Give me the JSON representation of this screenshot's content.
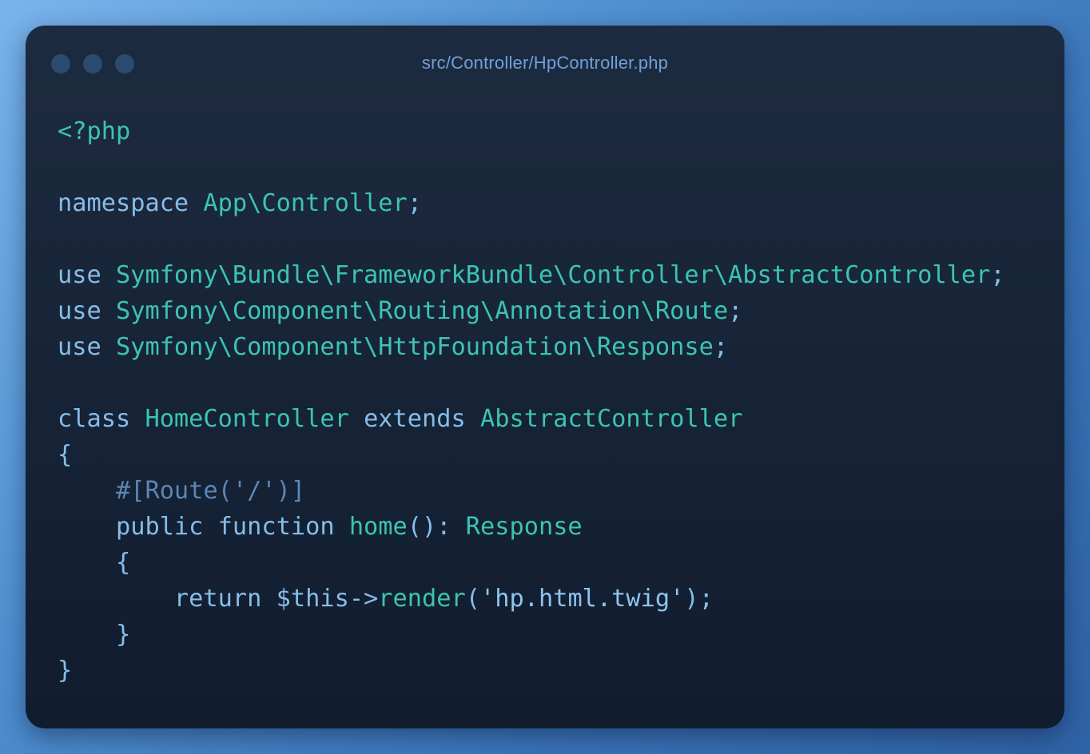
{
  "window": {
    "title": "src/Controller/HpController.php"
  },
  "code": {
    "lines": [
      [
        {
          "t": "<?php",
          "c": "tag"
        }
      ],
      [],
      [
        {
          "t": "namespace ",
          "c": "kw"
        },
        {
          "t": "App\\Controller",
          "c": "ns"
        },
        {
          "t": ";",
          "c": "punct"
        }
      ],
      [],
      [
        {
          "t": "use ",
          "c": "kw"
        },
        {
          "t": "Symfony\\Bundle\\FrameworkBundle\\Controller\\AbstractController",
          "c": "ns"
        },
        {
          "t": ";",
          "c": "punct"
        }
      ],
      [
        {
          "t": "use ",
          "c": "kw"
        },
        {
          "t": "Symfony\\Component\\Routing\\Annotation\\Route",
          "c": "ns"
        },
        {
          "t": ";",
          "c": "punct"
        }
      ],
      [
        {
          "t": "use ",
          "c": "kw"
        },
        {
          "t": "Symfony\\Component\\HttpFoundation\\Response",
          "c": "ns"
        },
        {
          "t": ";",
          "c": "punct"
        }
      ],
      [],
      [
        {
          "t": "class ",
          "c": "kw"
        },
        {
          "t": "HomeController",
          "c": "ns"
        },
        {
          "t": " extends ",
          "c": "kw"
        },
        {
          "t": "AbstractController",
          "c": "ns"
        }
      ],
      [
        {
          "t": "{",
          "c": "punct"
        }
      ],
      [
        {
          "t": "    ",
          "c": "punct"
        },
        {
          "t": "#[Route('/')]",
          "c": "attr"
        }
      ],
      [
        {
          "t": "    public function ",
          "c": "kw"
        },
        {
          "t": "home",
          "c": "fn"
        },
        {
          "t": "(): ",
          "c": "punct"
        },
        {
          "t": "Response",
          "c": "ns"
        }
      ],
      [
        {
          "t": "    {",
          "c": "punct"
        }
      ],
      [
        {
          "t": "        return ",
          "c": "kw"
        },
        {
          "t": "$this",
          "c": "var"
        },
        {
          "t": "->",
          "c": "punct"
        },
        {
          "t": "render",
          "c": "fn"
        },
        {
          "t": "(",
          "c": "punct"
        },
        {
          "t": "'hp.html.twig'",
          "c": "str"
        },
        {
          "t": ");",
          "c": "punct"
        }
      ],
      [
        {
          "t": "    }",
          "c": "punct"
        }
      ],
      [
        {
          "t": "}",
          "c": "punct"
        }
      ]
    ]
  }
}
